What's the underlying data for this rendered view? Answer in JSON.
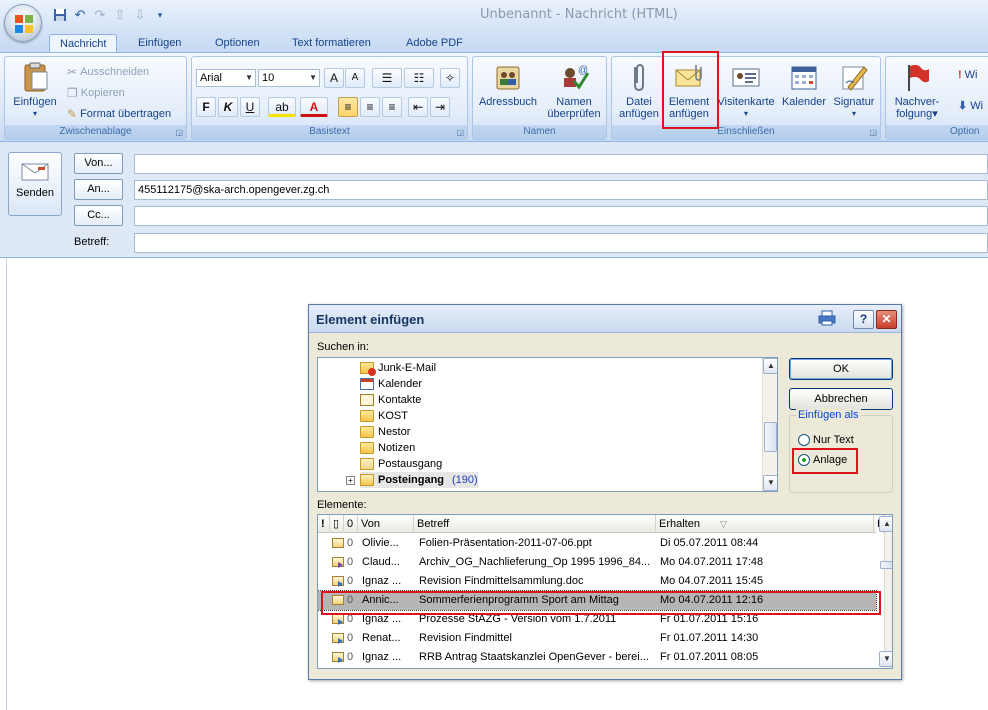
{
  "window": {
    "title": "Unbenannt - Nachricht (HTML)"
  },
  "tabs": [
    "Nachricht",
    "Einfügen",
    "Optionen",
    "Text formatieren",
    "Adobe PDF"
  ],
  "ribbon": {
    "clipboard": {
      "label": "Zwischenablage",
      "paste": "Einfügen",
      "cut": "Ausschneiden",
      "copy": "Kopieren",
      "format_painter": "Format übertragen"
    },
    "basic_text": {
      "label": "Basistext",
      "font": "Arial",
      "size": "10",
      "bold": "F",
      "italic": "K",
      "underline": "U"
    },
    "names": {
      "label": "Namen",
      "address_book": "Adressbuch",
      "check_names_1": "Namen",
      "check_names_2": "überprüfen"
    },
    "include": {
      "label": "Einschließen",
      "attach_file_1": "Datei",
      "attach_file_2": "anfügen",
      "attach_item_1": "Element",
      "attach_item_2": "anfügen",
      "business_card": "Visitenkarte",
      "calendar": "Kalender",
      "signature": "Signatur"
    },
    "options": {
      "label": "Option",
      "followup_1": "Nachver-",
      "followup_2": "folgung",
      "wi1": "Wi",
      "wi2": "Wi"
    }
  },
  "compose": {
    "send": "Senden",
    "from_btn": "Von...",
    "to_btn": "An...",
    "cc_btn": "Cc...",
    "subject_label": "Betreff:",
    "to_value": "455112175@ska-arch.opengever.zg.ch"
  },
  "dialog": {
    "title": "Element einfügen",
    "look_in_label": "Suchen in:",
    "folders": [
      {
        "name": "Junk-E-Mail",
        "icon": "junk"
      },
      {
        "name": "Kalender",
        "icon": "cal"
      },
      {
        "name": "Kontakte",
        "icon": "contact"
      },
      {
        "name": "KOST",
        "icon": "folder"
      },
      {
        "name": "Nestor",
        "icon": "folder"
      },
      {
        "name": "Notizen",
        "icon": "folder"
      },
      {
        "name": "Postausgang",
        "icon": "outbox"
      },
      {
        "name": "Posteingang",
        "icon": "inbox",
        "count": "(190)",
        "bold": true
      }
    ],
    "ok": "OK",
    "cancel": "Abbrechen",
    "insert_as_legend": "Einfügen als",
    "radio_text_only": "Nur Text",
    "radio_attachment": "Anlage",
    "items_label": "Elemente:",
    "columns": {
      "from": "Von",
      "subject": "Betreff",
      "received": "Erhalten",
      "k": "K"
    },
    "rows": [
      {
        "from": "Olivie...",
        "subject": "Folien-Präsentation-2011-07-06.ppt",
        "received": "Di 05.07.2011 08:44",
        "icon": "read"
      },
      {
        "from": "Claud...",
        "subject": "Archiv_OG_Nachlieferung_Op 1995 1996_84...",
        "received": "Mo 04.07.2011 17:48",
        "icon": "reply"
      },
      {
        "from": "Ignaz ...",
        "subject": "Revision Findmittelsammlung.doc",
        "received": "Mo 04.07.2011 15:45",
        "icon": "fwd"
      },
      {
        "from": "Annic...",
        "subject": "Sommerferienprogramm Sport am Mittag",
        "received": "Mo 04.07.2011 12:16",
        "icon": "read",
        "selected": true
      },
      {
        "from": "Ignaz ...",
        "subject": "Prozesse StAZG  - Version vom 1.7.2011",
        "received": "Fr 01.07.2011 15:16",
        "icon": "fwd"
      },
      {
        "from": "Renat...",
        "subject": "Revision Findmittel",
        "received": "Fr 01.07.2011 14:30",
        "icon": "fwd"
      },
      {
        "from": "Ignaz ...",
        "subject": "RRB Antrag Staatskanzlei OpenGever - berei...",
        "received": "Fr 01.07.2011 08:05",
        "icon": "fwd"
      }
    ]
  },
  "colors": {
    "highlight_box": "#e0121b"
  }
}
